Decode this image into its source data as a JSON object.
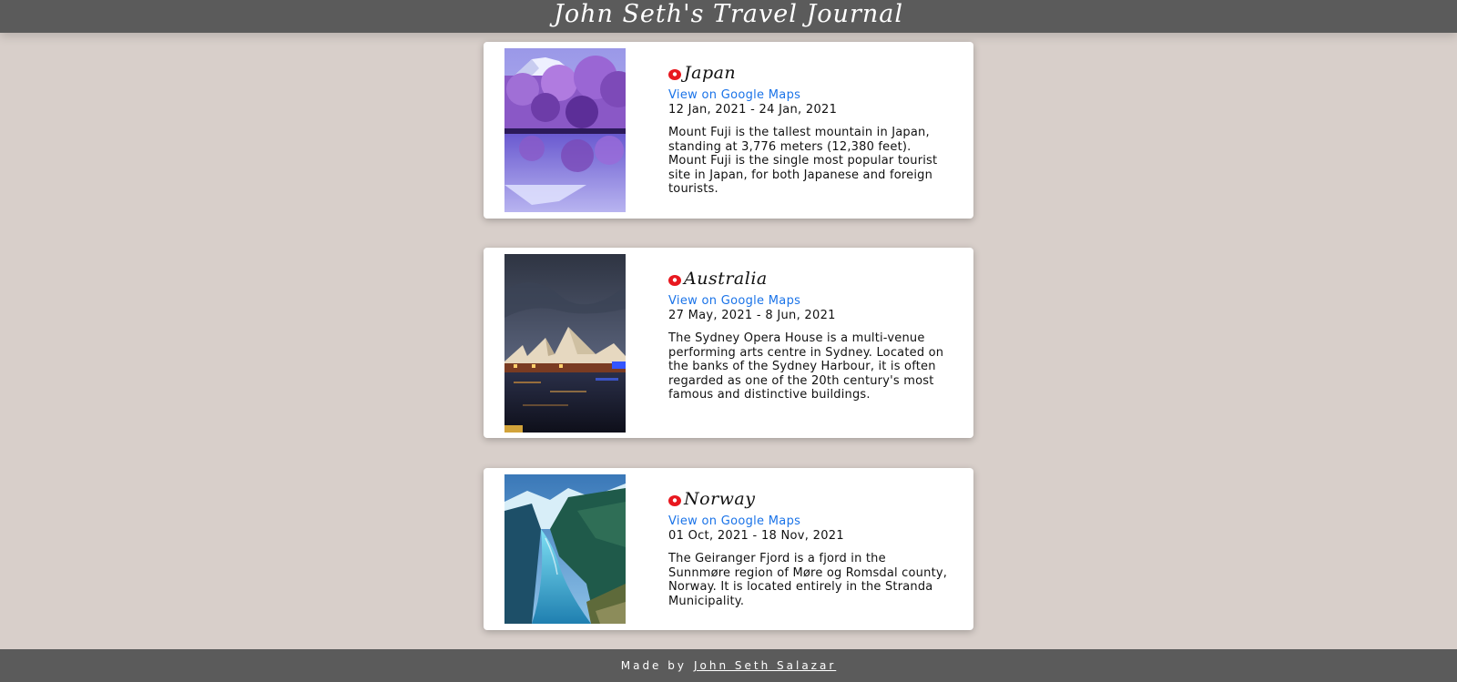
{
  "header": {
    "title": "John Seth's Travel Journal"
  },
  "entries": [
    {
      "place": "Japan",
      "map_link": "View on Google Maps",
      "dates": "12 Jan, 2021 - 24 Jan, 2021",
      "description": "Mount Fuji is the tallest mountain in Japan, standing at 3,776 meters (12,380 feet). Mount Fuji is the single most popular tourist site in Japan, for both Japanese and foreign tourists.",
      "image": "mount-fuji-cherry-blossoms-photo"
    },
    {
      "place": "Australia",
      "map_link": "View on Google Maps",
      "dates": "27 May, 2021 - 8 Jun, 2021",
      "description": "The Sydney Opera House is a multi-venue performing arts centre in Sydney. Located on the banks of the Sydney Harbour, it is often regarded as one of the 20th century's most famous and distinctive buildings.",
      "image": "sydney-opera-house-photo"
    },
    {
      "place": "Norway",
      "map_link": "View on Google Maps",
      "dates": "01 Oct, 2021 - 18 Nov, 2021",
      "description": "The Geiranger Fjord is a fjord in the Sunnmøre region of Møre og Romsdal county, Norway. It is located entirely in the Stranda Municipality.",
      "image": "geiranger-fjord-photo"
    }
  ],
  "footer": {
    "made_by": "Made by",
    "author": "John Seth Salazar"
  },
  "colors": {
    "background": "#d8cfca",
    "bar": "#5b5b5b",
    "link": "#1a73e8",
    "pin": "#e8181f"
  },
  "icons": {
    "location": "location-pin-icon"
  }
}
